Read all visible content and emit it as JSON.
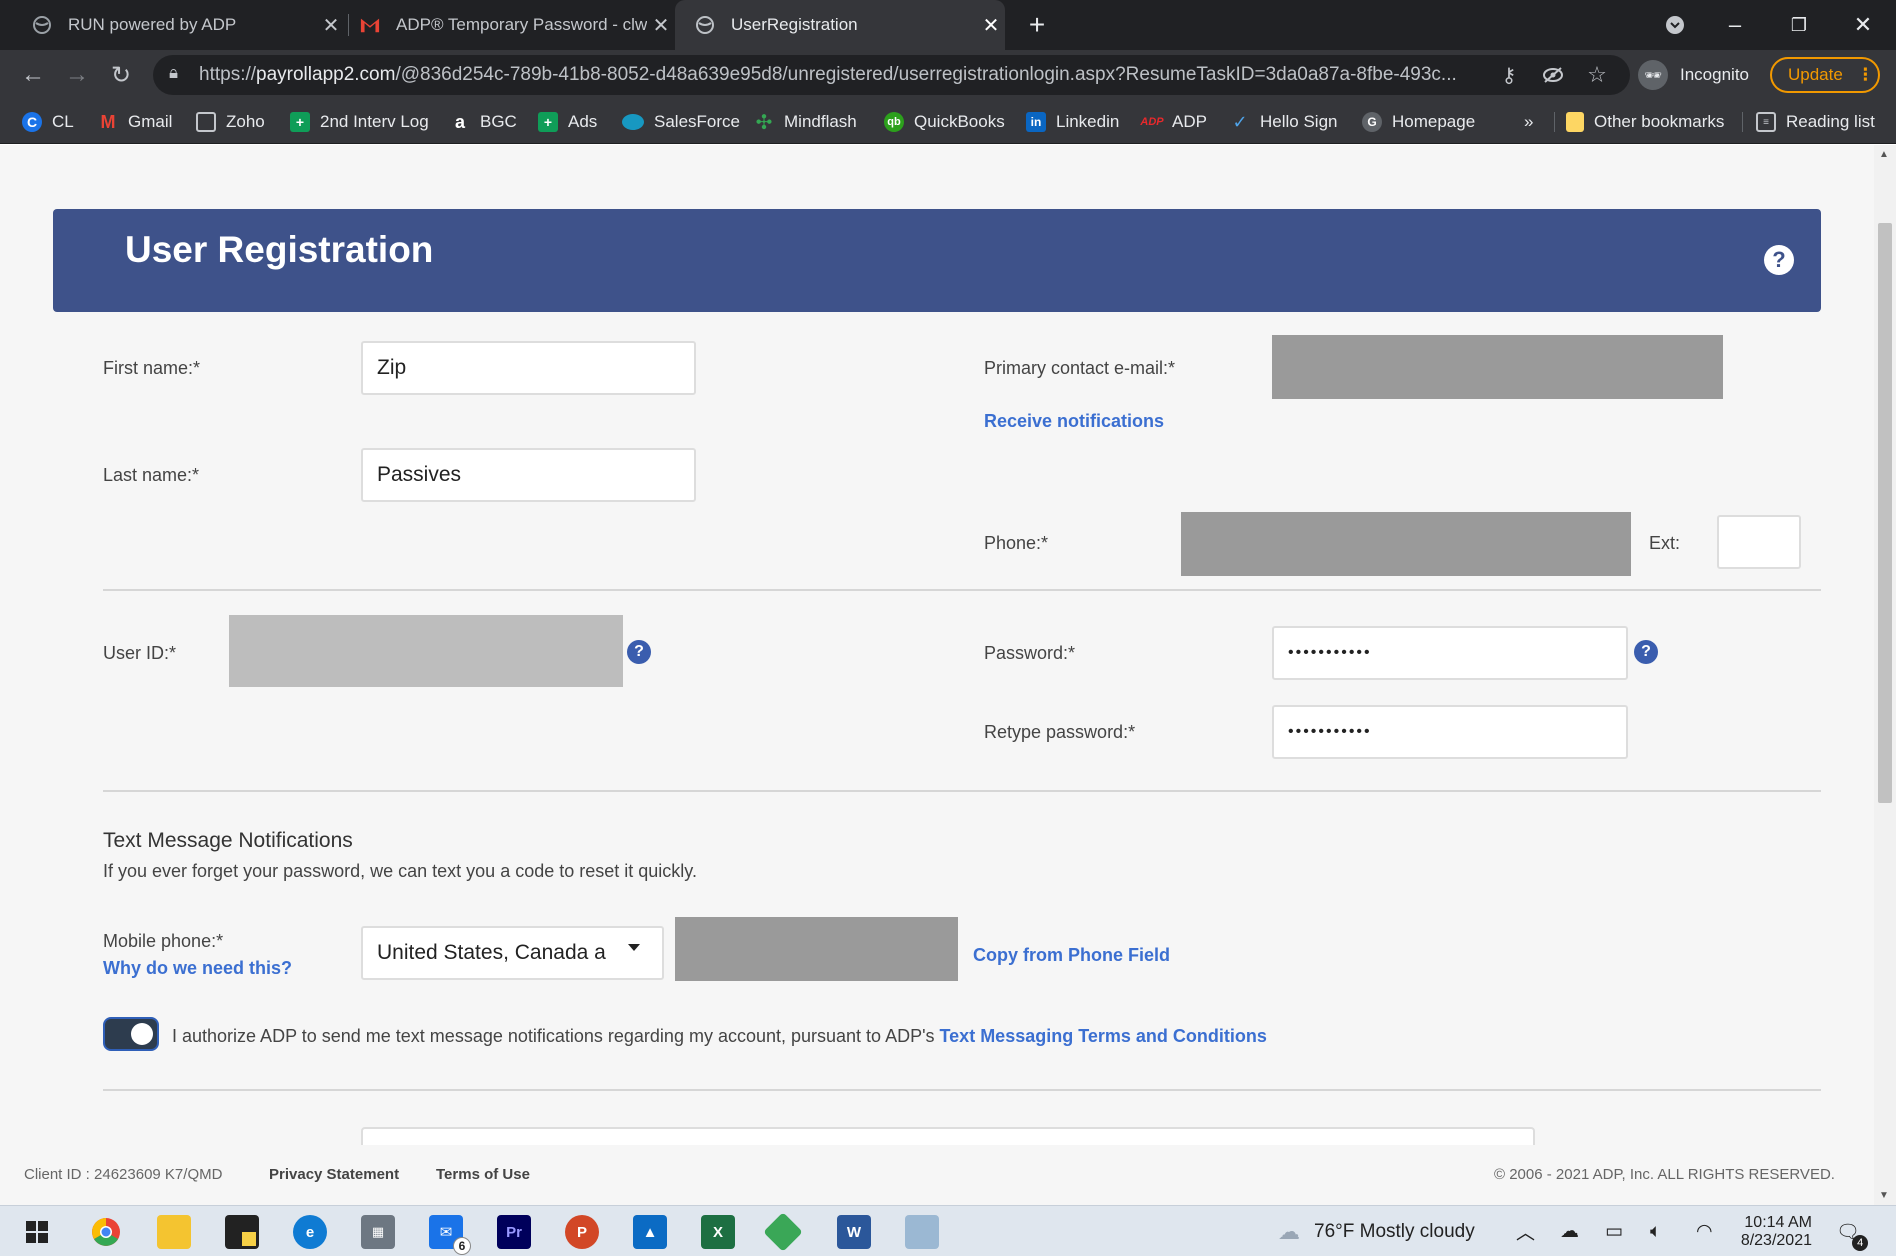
{
  "browser": {
    "tabs": [
      {
        "title": "RUN powered by ADP",
        "active": false
      },
      {
        "title": "ADP® Temporary Password - clw",
        "active": false
      },
      {
        "title": "UserRegistration",
        "active": true
      }
    ],
    "url_host": "payrollapp2.com",
    "url_rest": "/@836d254c-789b-41b8-8052-d48a639e95d8/unregistered/userregistrationlogin.aspx?ResumeTaskID=3da0a87a-8fbe-493c...",
    "url_prefix": "https://",
    "incognito_label": "Incognito",
    "update_label": "Update",
    "bookmarks": [
      "CL",
      "Gmail",
      "Zoho",
      "2nd Interv Log",
      "BGC",
      "Ads",
      "SalesForce",
      "Mindflash",
      "QuickBooks",
      "Linkedin",
      "ADP",
      "Hello Sign",
      "Homepage"
    ],
    "bookmarks_overflow": "»",
    "other_bookmarks": "Other bookmarks",
    "reading_list": "Reading list"
  },
  "form": {
    "title": "User Registration",
    "help_glyph": "?",
    "first_name_label": "First name:*",
    "first_name_value": "Zip",
    "last_name_label": "Last name:*",
    "last_name_value": "Passives",
    "email_label": "Primary contact e-mail:*",
    "receive_notifications": "Receive notifications",
    "phone_label": "Phone:*",
    "ext_label": "Ext:",
    "user_id_label": "User ID:*",
    "password_label": "Password:*",
    "password_value": "•••••••••••",
    "retype_password_label": "Retype password:*",
    "retype_password_value": "•••••••••••",
    "sms_heading": "Text Message Notifications",
    "sms_subtext": "If you ever forget your password, we can text you a code to reset it quickly.",
    "mobile_phone_label": "Mobile phone:*",
    "why_need_link": "Why do we need this?",
    "country_select_value": "United States, Canada a",
    "copy_phone_link": "Copy from Phone Field",
    "authorize_text": "I authorize ADP to send me text message notifications regarding my account, pursuant to ADP's ",
    "terms_link": "Text Messaging Terms and Conditions",
    "sms_toggle_on": true
  },
  "footer": {
    "client_id": "Client ID : 24623609 K7/QMD",
    "privacy": "Privacy Statement",
    "terms": "Terms of Use",
    "copyright": "© 2006 - 2021 ADP, Inc. ALL RIGHTS RESERVED."
  },
  "taskbar": {
    "weather": "76°F  Mostly cloudy",
    "time": "10:14 AM",
    "date": "8/23/2021",
    "mail_badge": "6",
    "notification_badge": "4"
  },
  "colors": {
    "header_blue": "#3e528a",
    "link_blue": "#3b6fd1",
    "update_orange": "#f29900"
  }
}
